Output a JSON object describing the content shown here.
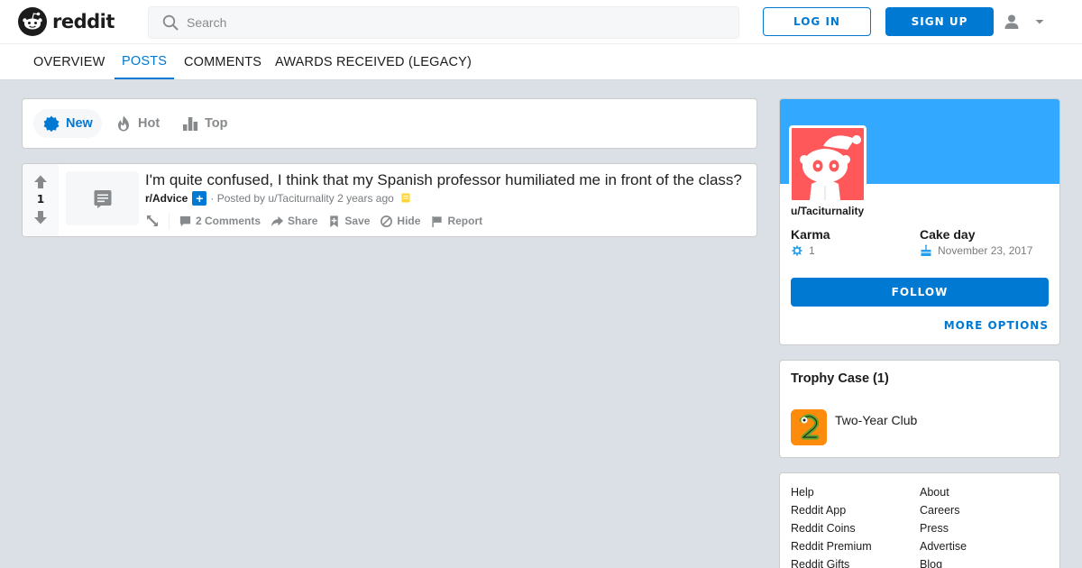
{
  "header": {
    "logo_text": "reddit",
    "search_placeholder": "Search",
    "login_label": "LOG IN",
    "signup_label": "SIGN UP"
  },
  "tabs": [
    {
      "label": "OVERVIEW",
      "active": false
    },
    {
      "label": "POSTS",
      "active": true
    },
    {
      "label": "COMMENTS",
      "active": false
    },
    {
      "label": "AWARDS RECEIVED (LEGACY)",
      "active": false
    }
  ],
  "sort": {
    "options": [
      {
        "label": "New",
        "icon": "new-icon",
        "active": true
      },
      {
        "label": "Hot",
        "icon": "hot-icon",
        "active": false
      },
      {
        "label": "Top",
        "icon": "top-icon",
        "active": false
      }
    ]
  },
  "post": {
    "votes": "1",
    "title": "I'm quite confused, I think that my Spanish professor humiliated me in front of the class?",
    "subreddit": "r/Advice",
    "join_symbol": "+",
    "posted_by": "· Posted by u/Taciturnality 2 years ago",
    "actions": {
      "comments": "2 Comments",
      "share": "Share",
      "save": "Save",
      "hide": "Hide",
      "report": "Report"
    }
  },
  "profile": {
    "username": "u/Taciturnality",
    "karma_label": "Karma",
    "karma_value": "1",
    "cakeday_label": "Cake day",
    "cakeday_value": "November 23, 2017",
    "follow_label": "FOLLOW",
    "more_options_label": "MORE OPTIONS"
  },
  "trophy_case": {
    "title": "Trophy Case (1)",
    "trophies": [
      {
        "name": "Two-Year Club",
        "icon": "two-year-club-icon"
      }
    ]
  },
  "footer": {
    "left": [
      "Help",
      "Reddit App",
      "Reddit Coins",
      "Reddit Premium",
      "Reddit Gifts"
    ],
    "right": [
      "About",
      "Careers",
      "Press",
      "Advertise",
      "Blog"
    ]
  },
  "colors": {
    "accent": "#0079d3",
    "banner": "#33a8ff",
    "avatar_bg": "#ff585b",
    "page_bg": "#dae0e6"
  }
}
